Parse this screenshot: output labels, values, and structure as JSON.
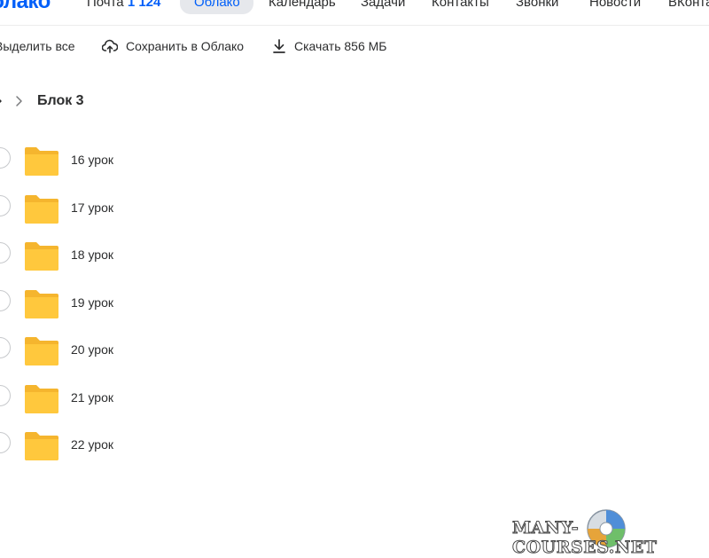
{
  "nav": {
    "logo": "Облако",
    "items": [
      {
        "label": "Почта"
      },
      {
        "label": "Облако"
      },
      {
        "label": "Календарь"
      },
      {
        "label": "Задачи"
      },
      {
        "label": "Контакты"
      },
      {
        "label": "Звонки"
      },
      {
        "label": "Новости"
      },
      {
        "label": "ВКонтакте"
      }
    ],
    "mail_count": "1 124"
  },
  "toolbar": {
    "select_all": "Выделить все",
    "save_to_cloud": "Сохранить в Облако",
    "download": "Скачать 856 МБ"
  },
  "breadcrumb": {
    "title": "Блок 3"
  },
  "files": [
    {
      "name": "16 урок",
      "icon": "folder-icon",
      "color": "#ffc83d"
    },
    {
      "name": "17 урок",
      "icon": "folder-icon",
      "color": "#ffc83d"
    },
    {
      "name": "18 урок",
      "icon": "folder-icon",
      "color": "#ffc83d"
    },
    {
      "name": "19 урок",
      "icon": "folder-icon",
      "color": "#ffc83d"
    },
    {
      "name": "20 урок",
      "icon": "folder-icon",
      "color": "#ffc83d"
    },
    {
      "name": "21 урок",
      "icon": "folder-icon",
      "color": "#ffc83d"
    },
    {
      "name": "22 урок",
      "icon": "folder-icon",
      "color": "#ffc83d"
    }
  ],
  "watermark": "MANY-COURSES.NET",
  "colors": {
    "accent": "#005ff9",
    "folder": "#ffc83d"
  }
}
